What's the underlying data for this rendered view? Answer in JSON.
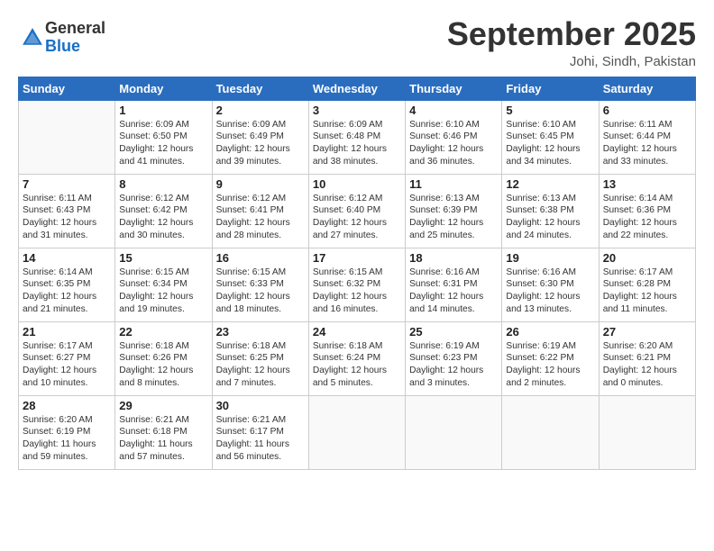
{
  "header": {
    "logo_general": "General",
    "logo_blue": "Blue",
    "title": "September 2025",
    "location": "Johi, Sindh, Pakistan"
  },
  "days_of_week": [
    "Sunday",
    "Monday",
    "Tuesday",
    "Wednesday",
    "Thursday",
    "Friday",
    "Saturday"
  ],
  "weeks": [
    [
      {
        "day": "",
        "detail": ""
      },
      {
        "day": "1",
        "detail": "Sunrise: 6:09 AM\nSunset: 6:50 PM\nDaylight: 12 hours\nand 41 minutes."
      },
      {
        "day": "2",
        "detail": "Sunrise: 6:09 AM\nSunset: 6:49 PM\nDaylight: 12 hours\nand 39 minutes."
      },
      {
        "day": "3",
        "detail": "Sunrise: 6:09 AM\nSunset: 6:48 PM\nDaylight: 12 hours\nand 38 minutes."
      },
      {
        "day": "4",
        "detail": "Sunrise: 6:10 AM\nSunset: 6:46 PM\nDaylight: 12 hours\nand 36 minutes."
      },
      {
        "day": "5",
        "detail": "Sunrise: 6:10 AM\nSunset: 6:45 PM\nDaylight: 12 hours\nand 34 minutes."
      },
      {
        "day": "6",
        "detail": "Sunrise: 6:11 AM\nSunset: 6:44 PM\nDaylight: 12 hours\nand 33 minutes."
      }
    ],
    [
      {
        "day": "7",
        "detail": "Sunrise: 6:11 AM\nSunset: 6:43 PM\nDaylight: 12 hours\nand 31 minutes."
      },
      {
        "day": "8",
        "detail": "Sunrise: 6:12 AM\nSunset: 6:42 PM\nDaylight: 12 hours\nand 30 minutes."
      },
      {
        "day": "9",
        "detail": "Sunrise: 6:12 AM\nSunset: 6:41 PM\nDaylight: 12 hours\nand 28 minutes."
      },
      {
        "day": "10",
        "detail": "Sunrise: 6:12 AM\nSunset: 6:40 PM\nDaylight: 12 hours\nand 27 minutes."
      },
      {
        "day": "11",
        "detail": "Sunrise: 6:13 AM\nSunset: 6:39 PM\nDaylight: 12 hours\nand 25 minutes."
      },
      {
        "day": "12",
        "detail": "Sunrise: 6:13 AM\nSunset: 6:38 PM\nDaylight: 12 hours\nand 24 minutes."
      },
      {
        "day": "13",
        "detail": "Sunrise: 6:14 AM\nSunset: 6:36 PM\nDaylight: 12 hours\nand 22 minutes."
      }
    ],
    [
      {
        "day": "14",
        "detail": "Sunrise: 6:14 AM\nSunset: 6:35 PM\nDaylight: 12 hours\nand 21 minutes."
      },
      {
        "day": "15",
        "detail": "Sunrise: 6:15 AM\nSunset: 6:34 PM\nDaylight: 12 hours\nand 19 minutes."
      },
      {
        "day": "16",
        "detail": "Sunrise: 6:15 AM\nSunset: 6:33 PM\nDaylight: 12 hours\nand 18 minutes."
      },
      {
        "day": "17",
        "detail": "Sunrise: 6:15 AM\nSunset: 6:32 PM\nDaylight: 12 hours\nand 16 minutes."
      },
      {
        "day": "18",
        "detail": "Sunrise: 6:16 AM\nSunset: 6:31 PM\nDaylight: 12 hours\nand 14 minutes."
      },
      {
        "day": "19",
        "detail": "Sunrise: 6:16 AM\nSunset: 6:30 PM\nDaylight: 12 hours\nand 13 minutes."
      },
      {
        "day": "20",
        "detail": "Sunrise: 6:17 AM\nSunset: 6:28 PM\nDaylight: 12 hours\nand 11 minutes."
      }
    ],
    [
      {
        "day": "21",
        "detail": "Sunrise: 6:17 AM\nSunset: 6:27 PM\nDaylight: 12 hours\nand 10 minutes."
      },
      {
        "day": "22",
        "detail": "Sunrise: 6:18 AM\nSunset: 6:26 PM\nDaylight: 12 hours\nand 8 minutes."
      },
      {
        "day": "23",
        "detail": "Sunrise: 6:18 AM\nSunset: 6:25 PM\nDaylight: 12 hours\nand 7 minutes."
      },
      {
        "day": "24",
        "detail": "Sunrise: 6:18 AM\nSunset: 6:24 PM\nDaylight: 12 hours\nand 5 minutes."
      },
      {
        "day": "25",
        "detail": "Sunrise: 6:19 AM\nSunset: 6:23 PM\nDaylight: 12 hours\nand 3 minutes."
      },
      {
        "day": "26",
        "detail": "Sunrise: 6:19 AM\nSunset: 6:22 PM\nDaylight: 12 hours\nand 2 minutes."
      },
      {
        "day": "27",
        "detail": "Sunrise: 6:20 AM\nSunset: 6:21 PM\nDaylight: 12 hours\nand 0 minutes."
      }
    ],
    [
      {
        "day": "28",
        "detail": "Sunrise: 6:20 AM\nSunset: 6:19 PM\nDaylight: 11 hours\nand 59 minutes."
      },
      {
        "day": "29",
        "detail": "Sunrise: 6:21 AM\nSunset: 6:18 PM\nDaylight: 11 hours\nand 57 minutes."
      },
      {
        "day": "30",
        "detail": "Sunrise: 6:21 AM\nSunset: 6:17 PM\nDaylight: 11 hours\nand 56 minutes."
      },
      {
        "day": "",
        "detail": ""
      },
      {
        "day": "",
        "detail": ""
      },
      {
        "day": "",
        "detail": ""
      },
      {
        "day": "",
        "detail": ""
      }
    ]
  ]
}
